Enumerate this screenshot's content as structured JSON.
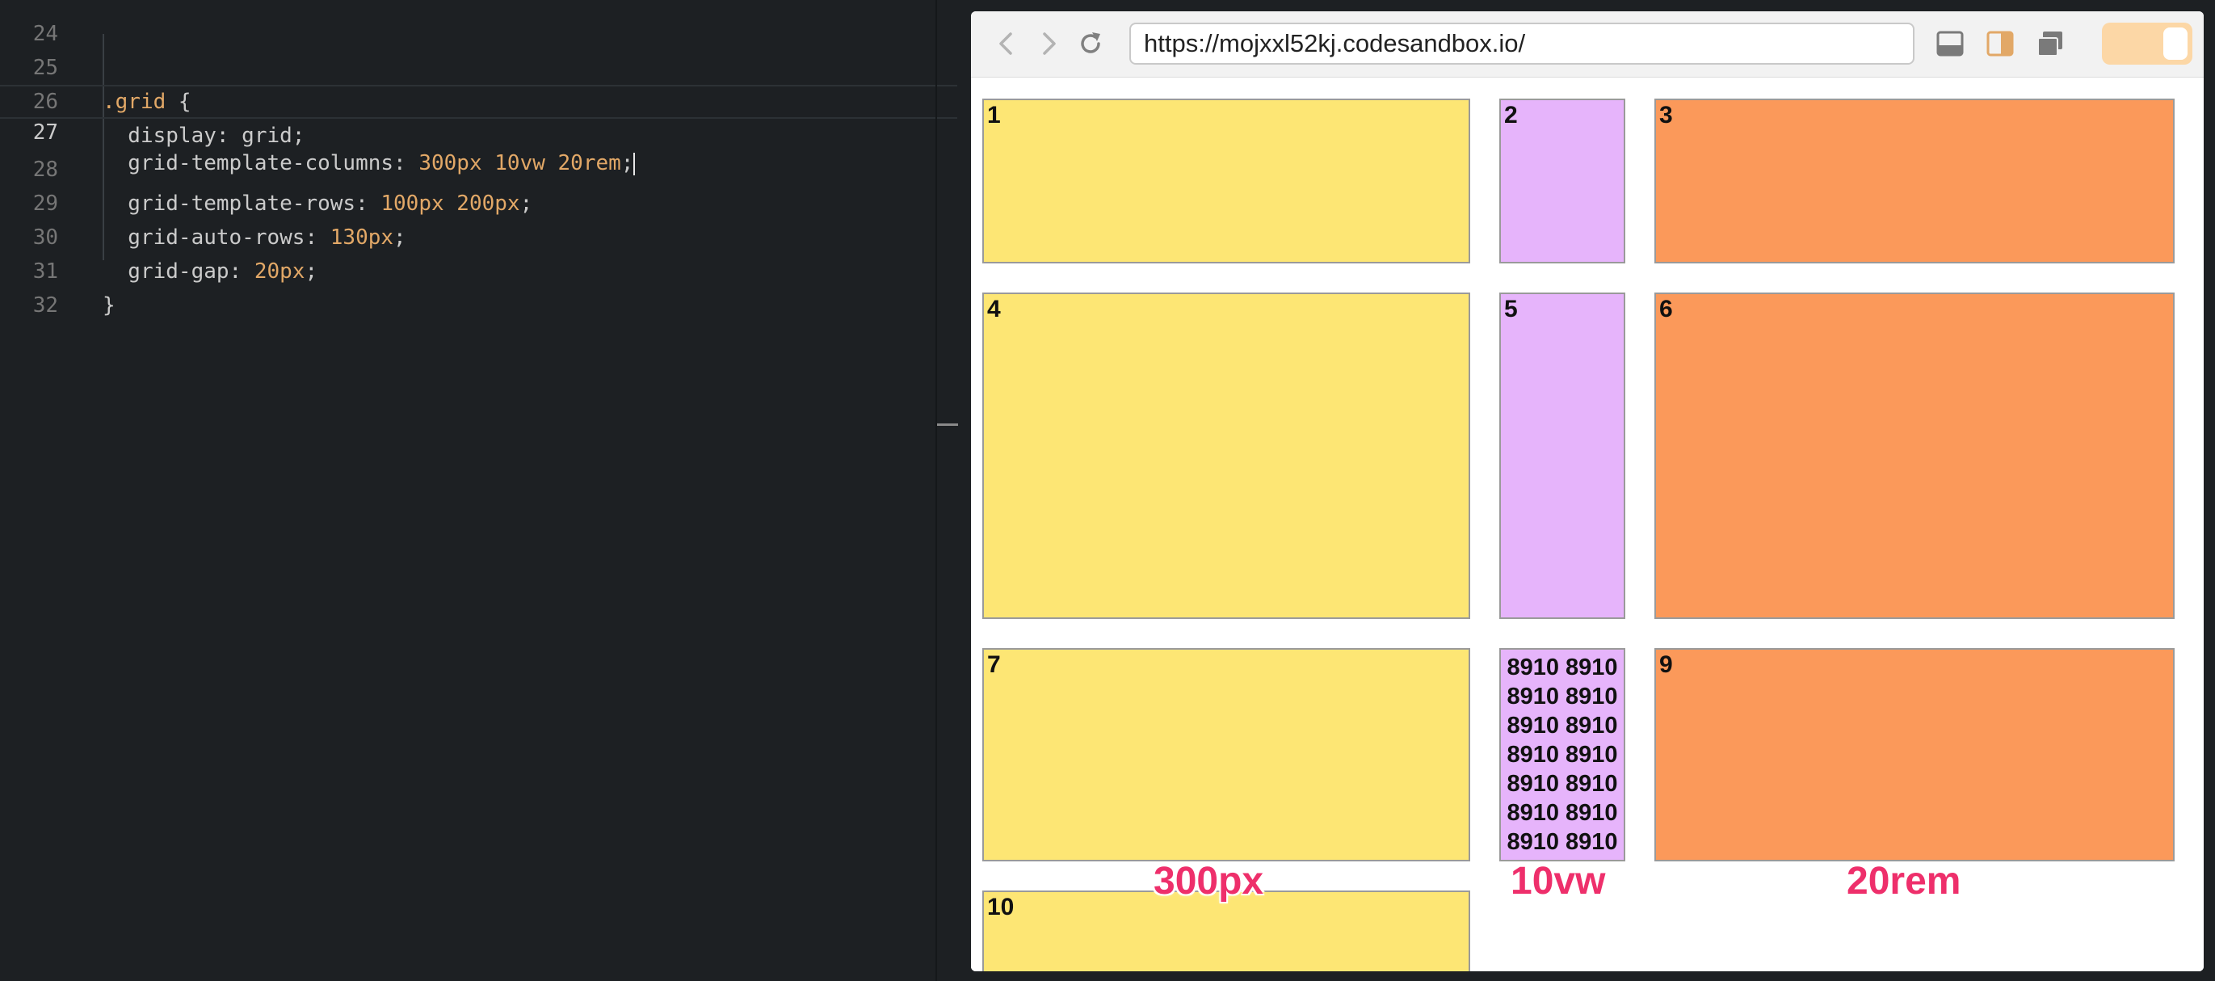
{
  "editor": {
    "lines": [
      {
        "num": "24",
        "sel": "",
        "prop": "",
        "val": "",
        "tail": ""
      },
      {
        "num": "25",
        "sel": ".grid",
        "prop": " {",
        "val": "",
        "tail": ""
      },
      {
        "num": "26",
        "sel": "",
        "prop": "  display: grid;",
        "val": "",
        "tail": ""
      },
      {
        "num": "27",
        "sel": "",
        "prop": "  grid-template-columns: ",
        "val": "300px 10vw 20rem",
        "tail": ";"
      },
      {
        "num": "28",
        "sel": "",
        "prop": "  grid-template-rows: ",
        "val": "100px 200px",
        "tail": ";"
      },
      {
        "num": "29",
        "sel": "",
        "prop": "  grid-auto-rows: ",
        "val": "130px",
        "tail": ";"
      },
      {
        "num": "30",
        "sel": "",
        "prop": "  grid-gap: ",
        "val": "20px",
        "tail": ";"
      },
      {
        "num": "31",
        "sel": "",
        "prop": "}",
        "val": "",
        "tail": ""
      },
      {
        "num": "32",
        "sel": "",
        "prop": "",
        "val": "",
        "tail": ""
      }
    ]
  },
  "browser": {
    "url": "https://mojxxl52kj.codesandbox.io/",
    "icons": {
      "back": "chevron-left-icon",
      "forward": "chevron-right-icon",
      "reload": "reload-icon",
      "console": "panel-bottom-icon",
      "split": "panel-split-icon",
      "windows": "copy-windows-icon"
    },
    "accent": "#fcd7a6"
  },
  "grid": {
    "cells": [
      {
        "label": "1",
        "color": "yellow"
      },
      {
        "label": "2",
        "color": "purple"
      },
      {
        "label": "3",
        "color": "orange"
      },
      {
        "label": "4",
        "color": "yellow"
      },
      {
        "label": "5",
        "color": "purple"
      },
      {
        "label": "6",
        "color": "orange"
      },
      {
        "label": "7",
        "color": "yellow"
      },
      {
        "label": "8910 8910 8910 8910 8910 8910 8910 8910 8910 8910 8910 8910 8910 8910",
        "color": "purple"
      },
      {
        "label": "9",
        "color": "orange"
      },
      {
        "label": "10",
        "color": "yellow"
      }
    ],
    "colors": {
      "yellow": "#fde674",
      "purple": "#e6b4fb",
      "orange": "#fb995a"
    },
    "column_labels": [
      "300px",
      "10vw",
      "20rem"
    ]
  }
}
